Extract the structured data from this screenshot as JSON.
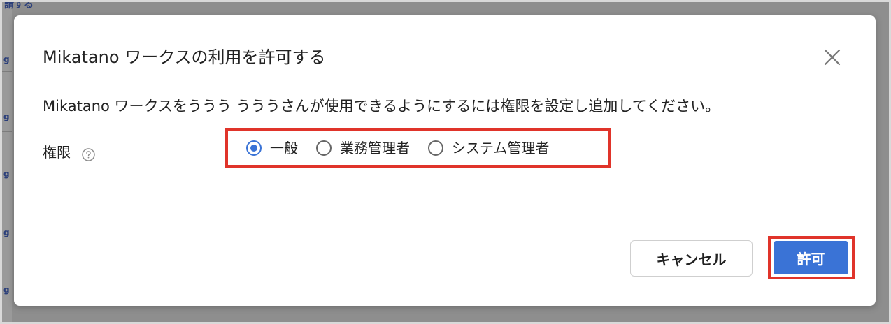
{
  "background": {
    "top_fragment": "請する",
    "side_mark": "g"
  },
  "dialog": {
    "title": "Mikatano ワークスの利用を許可する",
    "description": "Mikatano ワークスをううう うううさんが使用できるようにするには権限を設定し追加してください。",
    "permission_label": "権限",
    "options": [
      {
        "label": "一般",
        "checked": true
      },
      {
        "label": "業務管理者",
        "checked": false
      },
      {
        "label": "システム管理者",
        "checked": false
      }
    ],
    "cancel_label": "キャンセル",
    "allow_label": "許可"
  },
  "colors": {
    "accent": "#3a73d6",
    "highlight": "#e0342a",
    "overlay": "#8e8e8e"
  },
  "icons": {
    "close": "close-icon",
    "help": "help-icon"
  }
}
